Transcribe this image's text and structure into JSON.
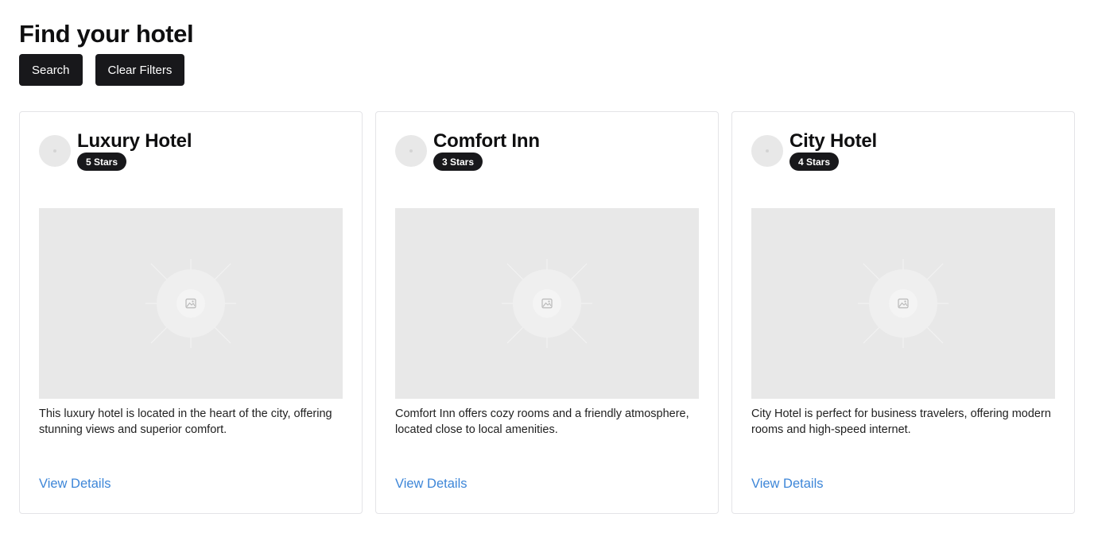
{
  "page": {
    "title": "Find your hotel"
  },
  "toolbar": {
    "search_label": "Search",
    "clear_label": "Clear Filters"
  },
  "hotels": [
    {
      "name": "Luxury Hotel",
      "rating": "5 Stars",
      "description": "This luxury hotel is located in the heart of the city, offering stunning views and superior comfort.",
      "link_label": "View Details"
    },
    {
      "name": "Comfort Inn",
      "rating": "3 Stars",
      "description": "Comfort Inn offers cozy rooms and a friendly atmosphere, located close to local amenities.",
      "link_label": "View Details"
    },
    {
      "name": "City Hotel",
      "rating": "4 Stars",
      "description": "City Hotel is perfect for business travelers, offering modern rooms and high-speed internet.",
      "link_label": "View Details"
    }
  ],
  "icons": {
    "avatar": "avatar-placeholder-icon",
    "image": "image-placeholder-icon"
  },
  "colors": {
    "button_bg": "#18181b",
    "link": "#3d86d8",
    "placeholder_bg": "#e8e8e8",
    "card_border": "#e4e4e7"
  }
}
